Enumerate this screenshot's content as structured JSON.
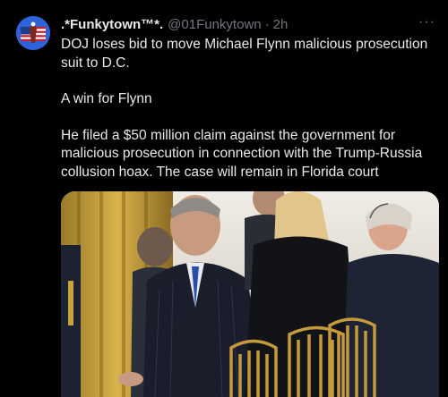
{
  "post": {
    "display_name": ".*Funkytown™*.",
    "handle": "@01Funkytown",
    "separator": "·",
    "time": "2h",
    "more_label": "···",
    "paragraphs": [
      "DOJ loses bid to move Michael Flynn malicious prosecution suit to D.C.",
      "A win for Flynn",
      "He filed a $50 million claim against the government for malicious prosecution in connection with the Trump-Russia collusion hoax. The case will remain in Florida court"
    ]
  },
  "icons": {
    "avatar": "american-flag-eagle-avatar",
    "more": "more-options-icon"
  }
}
